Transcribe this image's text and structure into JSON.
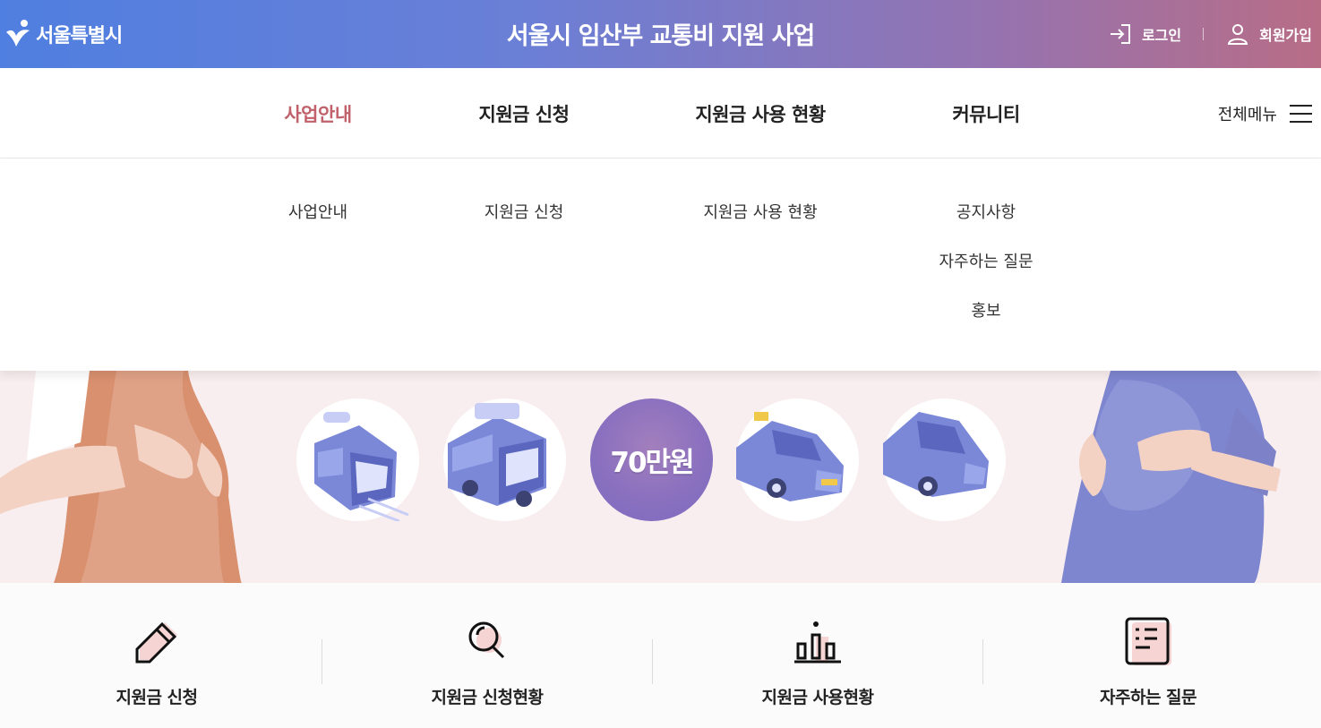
{
  "header": {
    "logo_text": "서울특별시",
    "title": "서울시 임산부 교통비 지원 사업",
    "login": "로그인",
    "signup": "회원가입"
  },
  "nav": {
    "items": [
      {
        "label": "사업안내",
        "active": true
      },
      {
        "label": "지원금 신청",
        "active": false
      },
      {
        "label": "지원금 사용 현황",
        "active": false
      },
      {
        "label": "커뮤니티",
        "active": false
      }
    ],
    "all_menu": "전체메뉴"
  },
  "submenu": {
    "business": [
      "사업안내"
    ],
    "apply": [
      "지원금 신청"
    ],
    "usage": [
      "지원금 사용 현황"
    ],
    "community": [
      "공지사항",
      "자주하는 질문",
      "홍보"
    ]
  },
  "hero": {
    "icons": [
      "subway-icon",
      "bus-icon",
      "taxi-icon",
      "car-icon"
    ],
    "amount": "70만원"
  },
  "quick_links": [
    {
      "label": "지원금 신청",
      "icon": "pencil-icon"
    },
    {
      "label": "지원금 신청현황",
      "icon": "magnifier-icon"
    },
    {
      "label": "지원금 사용현황",
      "icon": "bar-chart-icon"
    },
    {
      "label": "자주하는 질문",
      "icon": "document-icon"
    }
  ],
  "colors": {
    "header_start": "#4f7fe0",
    "header_end": "#b86d86",
    "active_nav": "#c0616b",
    "hero_bg": "#f9eeef",
    "amount_circle": "#8a70bf"
  }
}
